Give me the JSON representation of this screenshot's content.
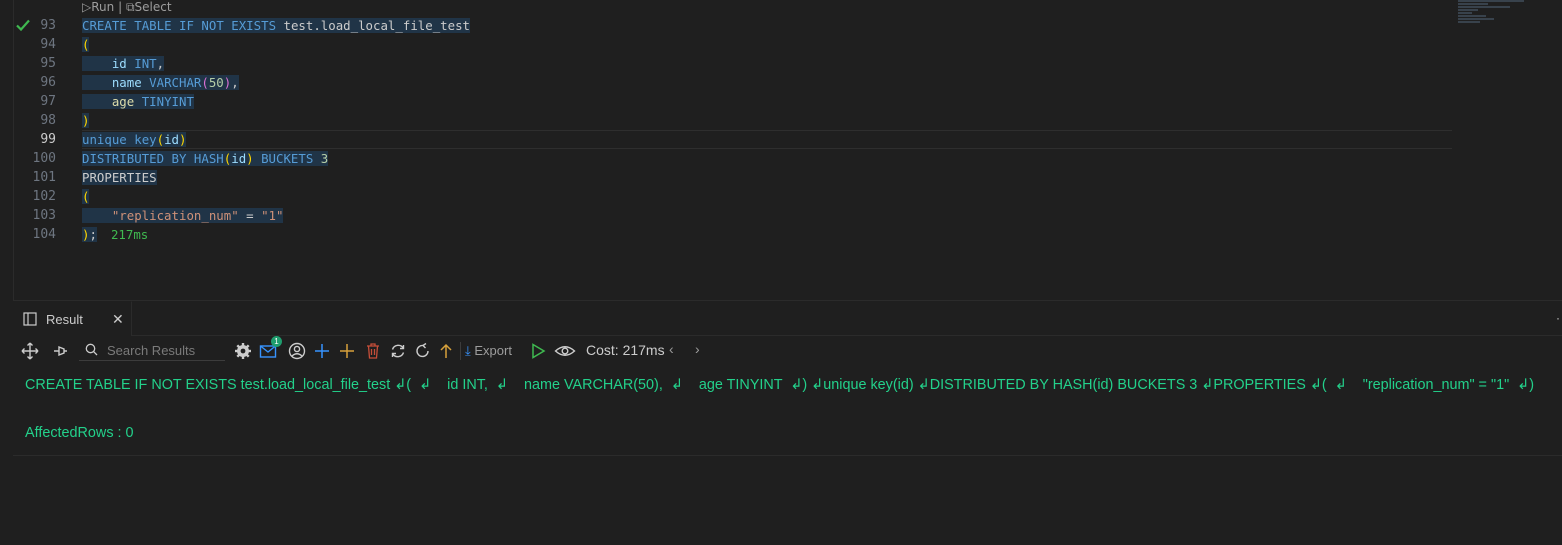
{
  "codelens": {
    "run": "Run",
    "separator": "|",
    "select": "Select"
  },
  "editor": {
    "lines": [
      {
        "num": "93"
      },
      {
        "num": "94"
      },
      {
        "num": "95"
      },
      {
        "num": "96"
      },
      {
        "num": "97"
      },
      {
        "num": "98"
      },
      {
        "num": "99"
      },
      {
        "num": "100"
      },
      {
        "num": "101"
      },
      {
        "num": "102"
      },
      {
        "num": "103"
      },
      {
        "num": "104"
      }
    ],
    "tokens": {
      "create": "CREATE",
      "table": "TABLE",
      "if": "IF",
      "not": "NOT",
      "exists": "EXISTS",
      "table_name": "test.load_local_file_test",
      "open_paren": "(",
      "close_paren": ")",
      "id": "id",
      "int": "INT",
      "comma": ",",
      "name": "name",
      "varchar": "VARCHAR",
      "fifty": "50",
      "age": "age",
      "tinyint": "TINYINT",
      "unique": "unique",
      "key": "key",
      "distributed": "DISTRIBUTED",
      "by": "BY",
      "hash": "HASH",
      "buckets": "BUCKETS",
      "three": "3",
      "properties": "PROPERTIES",
      "prop_key": "\"replication_num\"",
      "eq": "=",
      "prop_val": "\"1\"",
      "semicolon": ";"
    },
    "exec_time": "217ms"
  },
  "panel": {
    "tab_label": "Result",
    "tab_close": "✕",
    "more": "·",
    "search_placeholder": "Search Results",
    "badge_count": "1",
    "export_label": "Export",
    "cost_label": "Cost: 217ms",
    "prev": "‹",
    "next": "›"
  },
  "result": {
    "sql_text": "CREATE TABLE IF NOT EXISTS test.load_local_file_test ↲(  ↲    id INT,  ↲    name VARCHAR(50),  ↲    age TINYINT  ↲) ↲unique key(id) ↲DISTRIBUTED BY HASH(id) BUCKETS 3 ↲PROPERTIES ↲(  ↲    \"replication_num\" = \"1\"  ↲)",
    "affected_rows": "AffectedRows : 0"
  },
  "colors": {
    "keyword": "#569cd6",
    "string": "#ce9178",
    "number": "#b5cea8",
    "bracket": "#ffd700",
    "success": "#23d18b",
    "selection": "#203447"
  }
}
